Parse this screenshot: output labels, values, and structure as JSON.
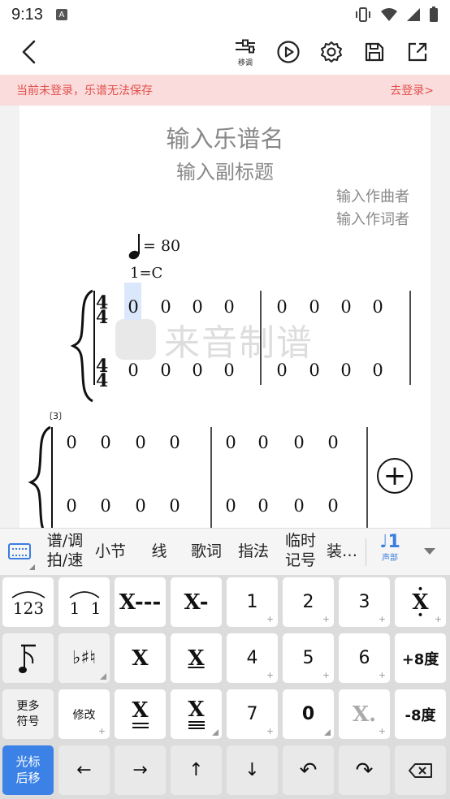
{
  "status_bar": {
    "time": "9:13",
    "app_badge": "A"
  },
  "toolbar": {
    "transpose_label": "移调"
  },
  "banner": {
    "message": "当前未登录，乐谱无法保存",
    "login_link": "去登录>"
  },
  "score": {
    "title_placeholder": "输入乐谱名",
    "subtitle_placeholder": "输入副标题",
    "composer_placeholder": "输入作曲者",
    "lyricist_placeholder": "输入作词者",
    "tempo_value": "= 80",
    "key_signature": "1=C",
    "time_signature_top": "4",
    "time_signature_bottom": "4",
    "measure_number_2": "〔3〕",
    "watermark": "来音制谱",
    "system1_upper": [
      "0",
      "0",
      "0",
      "0",
      "0",
      "0",
      "0",
      "0"
    ],
    "system1_lower": [
      "0",
      "0",
      "0",
      "0",
      "0",
      "0",
      "0",
      "0"
    ],
    "system2_upper": [
      "0",
      "0",
      "0",
      "0",
      "0",
      "0",
      "0",
      "0"
    ],
    "system2_lower": [
      "0",
      "0",
      "0",
      "0",
      "0",
      "0",
      "0",
      "0"
    ],
    "add_label": "+"
  },
  "categories": {
    "score_key": "谱/调",
    "beat_speed": "拍/速",
    "measure": "小节",
    "line": "线",
    "lyrics": "歌词",
    "fingering": "指法",
    "accidental_1": "临时",
    "accidental_2": "记号",
    "decoration": "装…",
    "voice_note": "♩1",
    "voice_label": "声部"
  },
  "keys": {
    "triplet": "123",
    "tie_1": "1",
    "tie_2": "1",
    "whole": "X---",
    "half": "X-",
    "n1": "1",
    "n2": "2",
    "n3": "3",
    "dot_above": "X",
    "rest_flag": "♪",
    "accidentals": "♭♯♮",
    "quarter": "X",
    "eighth": "X",
    "n4": "4",
    "n5": "5",
    "n6": "6",
    "octave_up": "+8度",
    "more_1": "更多",
    "more_2": "符号",
    "modify": "修改",
    "sixteenth": "X",
    "thirtysecond": "X",
    "n7": "7",
    "n0": "0",
    "dotted": "X.",
    "octave_down": "-8度",
    "cursor_1": "光标",
    "cursor_2": "后移",
    "left": "←",
    "right": "→",
    "up": "↑",
    "down": "↓",
    "undo": "↶",
    "redo": "↷"
  },
  "colors": {
    "accent": "#3c82e6",
    "banner_bg": "#fbdcdc",
    "banner_text": "#e0504c",
    "placeholder": "#888888"
  }
}
